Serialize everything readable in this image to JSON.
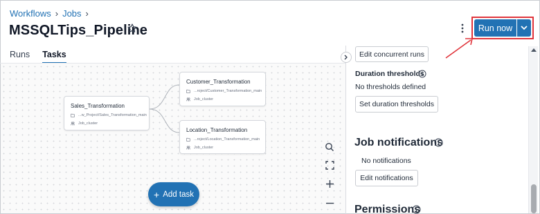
{
  "breadcrumb": {
    "items": [
      "Workflows",
      "Jobs"
    ]
  },
  "header": {
    "title": "MSSQLTips_Pipeline",
    "run_now_label": "Run now"
  },
  "tabs": [
    {
      "label": "Runs"
    },
    {
      "label": "Tasks",
      "active": true
    }
  ],
  "canvas": {
    "nodes": [
      {
        "name": "Sales_Transformation",
        "path": "...w_Project/Sales_Transformation_main",
        "cluster": "Job_cluster"
      },
      {
        "name": "Customer_Transformation",
        "path": "...roject/Customer_Transformation_main",
        "cluster": "Job_cluster"
      },
      {
        "name": "Location_Transformation",
        "path": "...roject/Location_Transformation_main",
        "cluster": "Job_cluster"
      }
    ],
    "add_task_label": "Add task",
    "controls": [
      "search-icon",
      "fit-view-icon",
      "zoom-in-icon",
      "zoom-out-icon"
    ]
  },
  "panel": {
    "edit_concurrent_runs": "Edit concurrent runs",
    "duration_thresholds_label": "Duration thresholds",
    "no_thresholds": "No thresholds defined",
    "set_duration_thresholds": "Set duration thresholds",
    "job_notifications_heading": "Job notifications",
    "no_notifications": "No notifications",
    "edit_notifications": "Edit notifications",
    "permissions_heading": "Permissions"
  },
  "colors": {
    "accent": "#2272b4",
    "highlight": "#e0333a"
  }
}
